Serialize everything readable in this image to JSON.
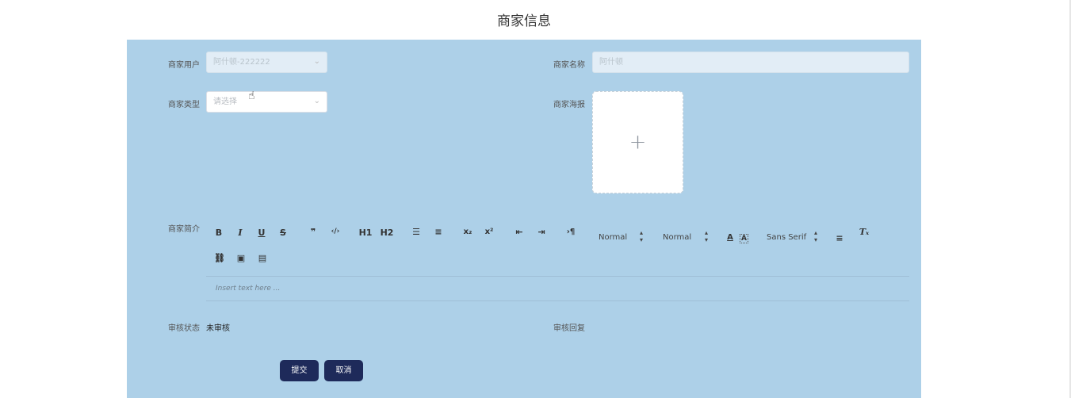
{
  "title": "商家信息",
  "form": {
    "merchant_user": {
      "label": "商家用户",
      "value": "阿什顿-222222"
    },
    "merchant_name": {
      "label": "商家名称",
      "value": "阿什顿"
    },
    "merchant_type": {
      "label": "商家类型",
      "placeholder": "请选择"
    },
    "merchant_poster": {
      "label": "商家海报",
      "upload_icon": "plus-icon"
    },
    "merchant_intro": {
      "label": "商家简介",
      "editor": {
        "header_1": "H1",
        "header_2": "H2",
        "size_select": "Normal",
        "header_select": "Normal",
        "font_select": "Sans Serif",
        "placeholder": "Insert text here ..."
      }
    },
    "review_status": {
      "label": "审核状态",
      "value": "未审核"
    },
    "review_reply": {
      "label": "审核回复",
      "value": ""
    }
  },
  "buttons": {
    "submit": "提交",
    "cancel": "取消"
  },
  "colors": {
    "panel_bg": "#add0e8",
    "button_bg": "#1e2a5a"
  }
}
